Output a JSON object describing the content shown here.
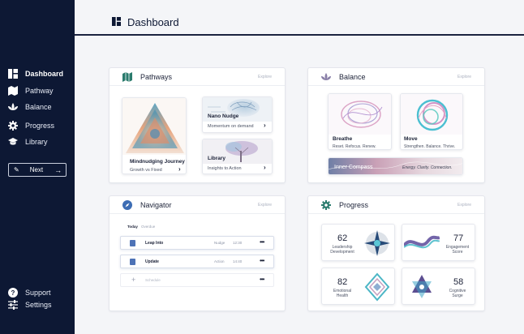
{
  "header": {
    "title": "Dashboard"
  },
  "sidebar": {
    "items": [
      {
        "label": "Dashboard",
        "icon": "dashboard-icon"
      },
      {
        "label": "Pathway",
        "icon": "map-icon"
      },
      {
        "label": "Balance",
        "icon": "lotus-icon"
      },
      {
        "label": "Progress",
        "icon": "gear-icon"
      },
      {
        "label": "Library",
        "icon": "graduation-cap-icon"
      }
    ],
    "next_label": "Next",
    "bottom": [
      {
        "label": "Support",
        "icon": "help-icon"
      },
      {
        "label": "Settings",
        "icon": "sliders-icon"
      }
    ]
  },
  "pathways": {
    "title": "Pathways",
    "explore": "Explore",
    "main": {
      "title": "Mindnudging Journey",
      "subtitle": "Growth vs Fixed"
    },
    "nano": {
      "title": "Nano Nudge",
      "subtitle": "Momentum on demand"
    },
    "library": {
      "title": "Library",
      "subtitle": "Insights to Action"
    }
  },
  "balance": {
    "title": "Balance",
    "explore": "Explore",
    "breathe": {
      "title": "Breathe",
      "subtitle": "Reset. Refocus. Renew."
    },
    "move": {
      "title": "Move",
      "subtitle": "Strengthen. Balance. Thrive."
    },
    "compass": {
      "title": "Inner Compass",
      "subtitle": "Energy. Clarity. Connection."
    }
  },
  "navigator": {
    "title": "Navigator",
    "explore": "Explore",
    "tabs": [
      "Today",
      "Overdue"
    ],
    "rows": [
      {
        "label": "Leap Into",
        "source": "Nudge",
        "time": "12:30"
      },
      {
        "label": "Update",
        "source": "Action",
        "time": "14:40"
      }
    ],
    "add_placeholder": "Schedule"
  },
  "progress": {
    "title": "Progress",
    "explore": "Explore",
    "stats": [
      {
        "value": "62",
        "label_1": "Leadership",
        "label_2": "Development"
      },
      {
        "value": "77",
        "label_1": "Engagement",
        "label_2": "Score"
      },
      {
        "value": "82",
        "label_1": "Emotional",
        "label_2": "Health"
      },
      {
        "value": "58",
        "label_1": "Cognitive",
        "label_2": "Surge"
      }
    ]
  },
  "colors": {
    "sidebar": "#0d1834",
    "accent": "#2a7b6d",
    "doc": "#4d72b6"
  }
}
